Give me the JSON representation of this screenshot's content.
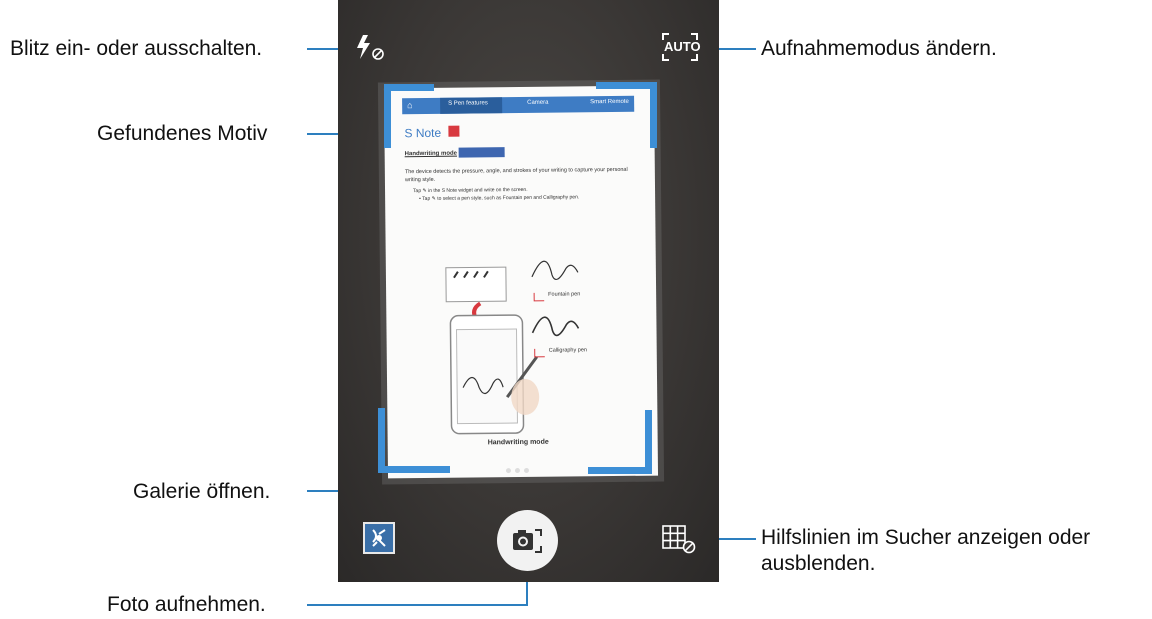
{
  "callouts": {
    "flash": "Blitz ein- oder ausschalten.",
    "shooting_mode": "Aufnahmemodus ändern.",
    "detected_subject": "Gefundenes Motiv",
    "gallery": "Galerie öffnen.",
    "take_photo": "Foto aufnehmen.",
    "guidelines": "Hilfslinien im Sucher anzeigen oder ausblenden."
  },
  "camera": {
    "mode_badge": "AUTO"
  },
  "document": {
    "tabs": [
      "S Pen features",
      "Camera",
      "Smart Remote"
    ],
    "title": "S Note",
    "section": "Handwriting mode",
    "intro": "The device detects the pressure, angle, and strokes of your writing to capture your personal writing style.",
    "step1": "Tap ✎ in the S Note widget and write on the screen.",
    "step2": "• Tap ✎ to select a pen style, such as Fountain pen and Calligraphy pen.",
    "pen1": "Fountain pen",
    "pen2": "Calligraphy pen",
    "caption": "Handwriting mode"
  },
  "colors": {
    "accent": "#2d7fbf",
    "frame_corners": "#3d8fd6",
    "viewfinder_bg": "#3a3735"
  }
}
